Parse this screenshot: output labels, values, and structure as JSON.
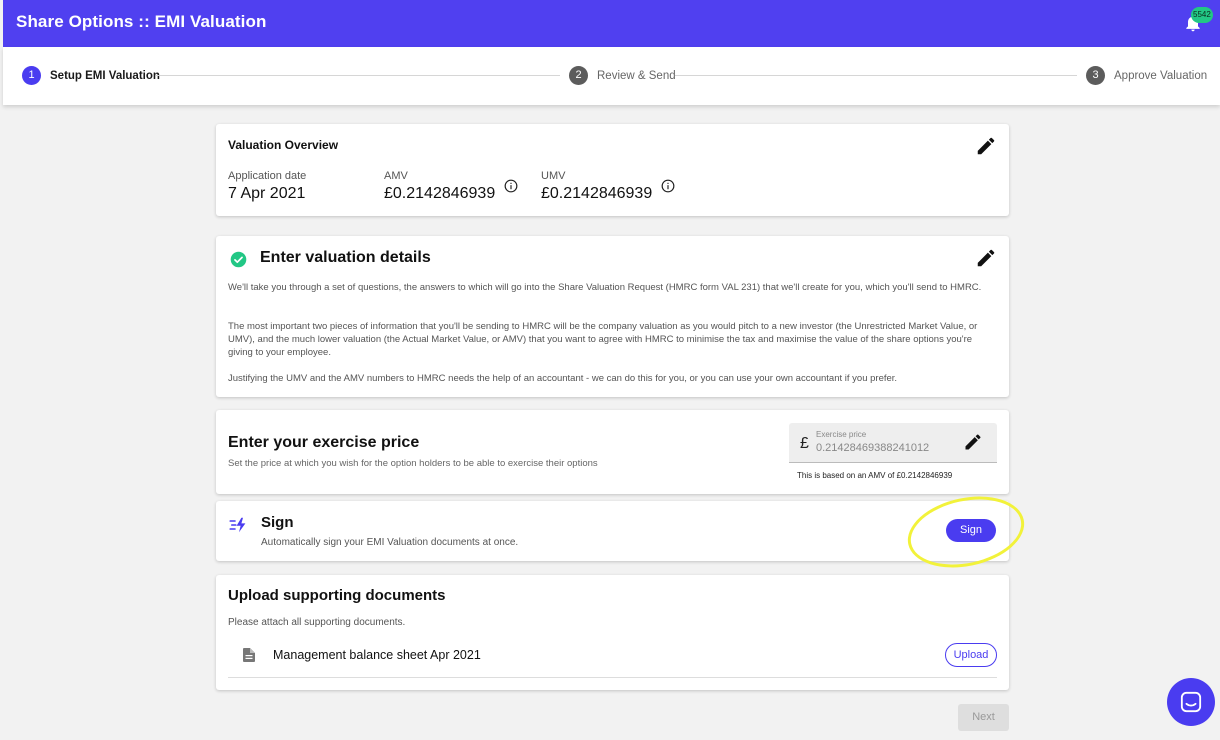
{
  "header": {
    "title": "Share Options :: EMI Valuation",
    "notification_count": "5542"
  },
  "stepper": {
    "steps": [
      {
        "number": "1",
        "label": "Setup EMI Valuation",
        "active": true
      },
      {
        "number": "2",
        "label": "Review & Send",
        "active": false
      },
      {
        "number": "3",
        "label": "Approve Valuation",
        "active": false
      }
    ]
  },
  "overview": {
    "title": "Valuation Overview",
    "application_date_label": "Application date",
    "application_date": "7 Apr 2021",
    "amv_label": "AMV",
    "amv_value": "£0.2142846939",
    "umv_label": "UMV",
    "umv_value": "£0.2142846939"
  },
  "valuation_details": {
    "title": "Enter valuation details",
    "paragraphs": [
      "We'll take you through a set of questions, the answers to which will go into the Share Valuation Request (HMRC form VAL 231) that we'll create for you, which you'll send to HMRC.",
      "The most important two pieces of information that you'll be sending to HMRC will be the company valuation as you would pitch to a new investor (the Unrestricted Market Value, or UMV), and the much lower valuation (the Actual Market Value, or AMV) that you want to agree with HMRC to minimise the tax and maximise the value of the share options you're giving to your employee.",
      "Justifying the UMV and the AMV numbers to HMRC needs the help of an accountant - we can do this for you, or you can use your own accountant if you prefer."
    ]
  },
  "exercise_price": {
    "title": "Enter your exercise price",
    "subtitle": "Set the price at which you wish for the option holders to be able to exercise their options",
    "field_label": "Exercise price",
    "currency": "£",
    "value": "0.21428469388241012",
    "note": "This is based on an AMV of £0.2142846939"
  },
  "sign": {
    "title": "Sign",
    "subtitle": "Automatically sign your EMI Valuation documents at once.",
    "button_label": "Sign"
  },
  "upload": {
    "title": "Upload supporting documents",
    "subtitle": "Please attach all supporting documents.",
    "documents": [
      {
        "name": "Management balance sheet Apr 2021",
        "button_label": "Upload"
      }
    ]
  },
  "footer": {
    "next_label": "Next"
  },
  "colors": {
    "brand": "#5040f0",
    "accent": "#4a3cf0",
    "success": "#22c785",
    "highlight": "#f2f23a"
  }
}
